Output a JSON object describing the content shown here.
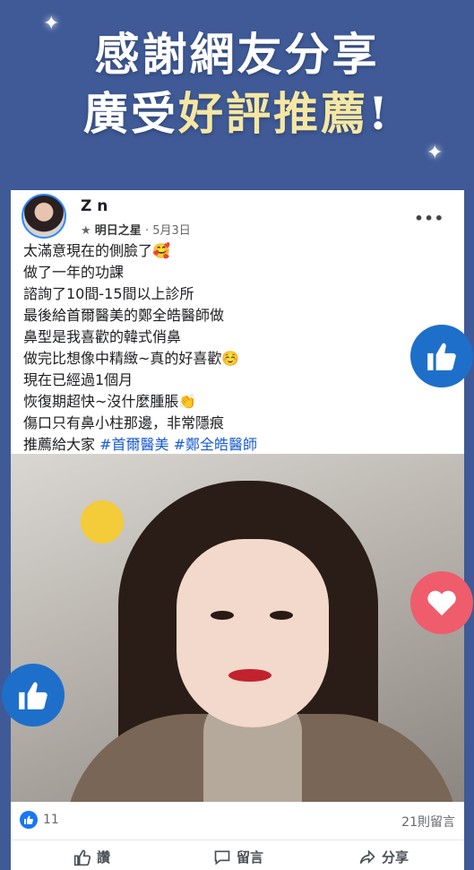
{
  "headline": {
    "line1": "感謝網友分享",
    "line2_part1": "廣受",
    "line2_accent": "好評推薦",
    "line2_part2": "!"
  },
  "post": {
    "author": "Z   n",
    "badge": "明日之星",
    "date": "5月3日",
    "lines": [
      "太滿意現在的側臉了🥰",
      "做了一年的功課",
      "諮詢了10間-15間以上診所",
      "最後給首爾醫美的鄭全皓醫師做",
      "鼻型是我喜歡的韓式俏鼻",
      "做完比想像中精緻~真的好喜歡☺️",
      "現在已經過1個月",
      "恢復期超快~沒什麼腫脹👏",
      "傷口只有鼻小柱那邊，非常隱痕"
    ],
    "last_line_prefix": "推薦給大家 ",
    "hashtags": [
      "#首爾醫美",
      "#鄭全皓醫師"
    ]
  },
  "reactions": {
    "likes": "11",
    "comments": "21則留言"
  },
  "actions": {
    "like": "讚",
    "comment": "留言",
    "share": "分享"
  },
  "colors": {
    "background": "#3f5a97",
    "accent_text": "#f5e7a3",
    "hashtag": "#1a5bd6",
    "facebook_blue": "#1877f2"
  }
}
